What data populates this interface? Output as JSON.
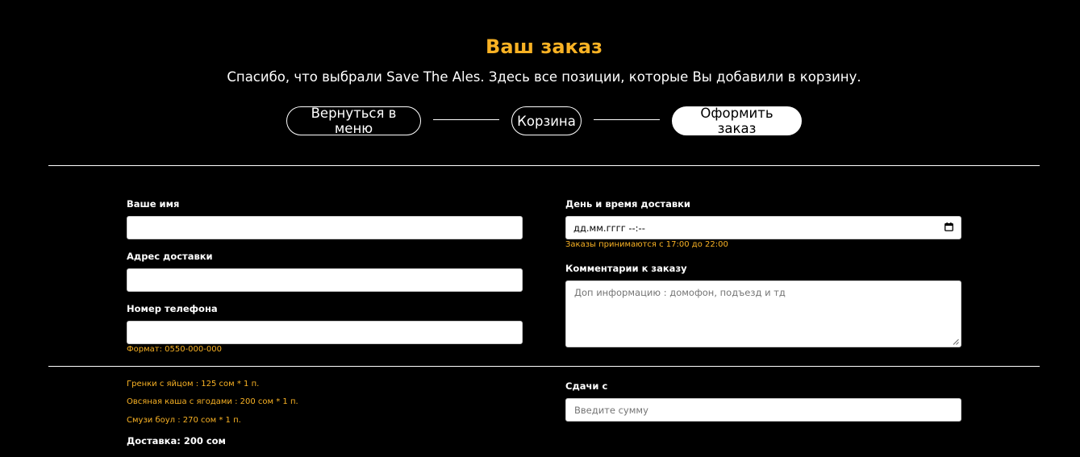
{
  "header": {
    "title": "Ваш заказ",
    "subtitle": "Спасибо, что выбрали Save The Ales. Здесь все позиции, которые Вы добавили в корзину."
  },
  "steps": [
    {
      "label": "Вернуться в меню",
      "active": false
    },
    {
      "label": "Корзина",
      "active": false
    },
    {
      "label": "Оформить заказ",
      "active": true
    }
  ],
  "form": {
    "name_label": "Ваше имя",
    "name_value": "",
    "address_label": "Адрес доставки",
    "address_value": "",
    "phone_label": "Номер телефона",
    "phone_value": "",
    "phone_hint": "Формат: 0550-000-000",
    "datetime_label": "День и время доставки",
    "datetime_value": "дд.мм.гггг --:--",
    "datetime_hint": "Заказы принимаются с 17:00 до 22:00",
    "comment_label": "Комментарии к заказу",
    "comment_placeholder": "Доп информацию : домофон, подъезд и тд",
    "change_label": "Сдачи с",
    "change_placeholder": "Введите сумму"
  },
  "order": {
    "items": [
      "Гренки с яйцом : 125 сом * 1 п.",
      "Овсяная каша с ягодами : 200 сом * 1 п.",
      "Смузи боул : 270 сом * 1 п."
    ],
    "delivery": "Доставка: 200 сом"
  },
  "colors": {
    "accent": "#f9b224",
    "background": "#000000",
    "text": "#ffffff"
  }
}
